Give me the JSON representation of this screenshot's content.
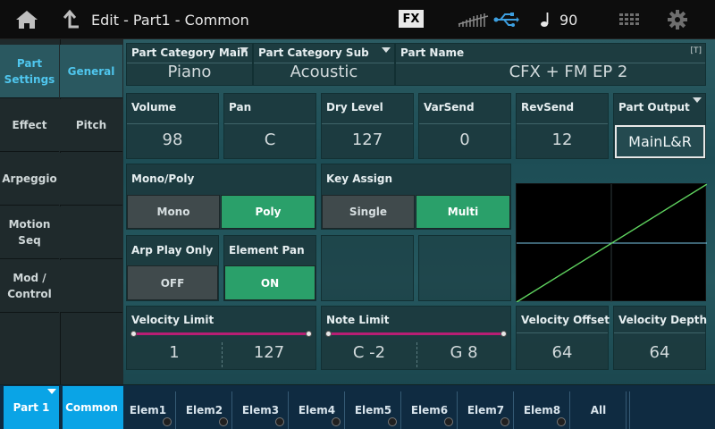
{
  "header": {
    "home_icon": "home-icon",
    "back_icon": "up-arrow-icon",
    "title": "Edit - Part1 - Common",
    "fx_label": "FX",
    "tempo_icon": "quarter-note-icon",
    "tempo": "90",
    "usb_icon": "usb-icon",
    "keyboard_icon": "keyboard-icon",
    "settings_icon": "gear-icon"
  },
  "nav_primary": [
    {
      "label": "Part\nSettings",
      "active": true
    },
    {
      "label": "Effect"
    },
    {
      "label": "Arpeggio"
    },
    {
      "label": "Motion\nSeq"
    },
    {
      "label": "Mod /\nControl"
    }
  ],
  "nav_secondary": [
    {
      "label": "General",
      "active": true
    },
    {
      "label": "Pitch"
    }
  ],
  "part": {
    "category_main_label": "Part Category Main",
    "category_main_value": "Piano",
    "category_sub_label": "Part Category Sub",
    "category_sub_value": "Acoustic",
    "name_label": "Part Name",
    "name_value": "CFX + FM EP 2",
    "name_badge": "[T]"
  },
  "params": {
    "volume_label": "Volume",
    "volume_value": "98",
    "pan_label": "Pan",
    "pan_value": "C",
    "dry_label": "Dry Level",
    "dry_value": "127",
    "varsend_label": "VarSend",
    "varsend_value": "0",
    "revsend_label": "RevSend",
    "revsend_value": "12",
    "output_label": "Part Output",
    "output_value": "MainL&R",
    "monopoly_label": "Mono/Poly",
    "mono_label": "Mono",
    "poly_label": "Poly",
    "keyassign_label": "Key Assign",
    "single_label": "Single",
    "multi_label": "Multi",
    "arp_label": "Arp Play Only",
    "arp_value": "OFF",
    "elempan_label": "Element Pan",
    "elempan_value": "ON",
    "vellimit_label": "Velocity Limit",
    "vellimit_low": "1",
    "vellimit_high": "127",
    "notelimit_label": "Note Limit",
    "notelimit_low": "C -2",
    "notelimit_high": "G 8",
    "veloffset_label": "Velocity Offset",
    "veloffset_value": "64",
    "veldepth_label": "Velocity Depth",
    "veldepth_value": "64"
  },
  "velocity_curve": {
    "offset": 64,
    "depth": 64
  },
  "colors": {
    "accent_blue": "#0aa4e6",
    "on_green": "#2aa06a",
    "slider_magenta": "#b81e74",
    "curve_green": "#5fd35f",
    "curve_center_line": "#7ac8e8"
  },
  "bottom_tabs": {
    "part": "Part 1",
    "common": "Common",
    "elements": [
      "Elem1",
      "Elem2",
      "Elem3",
      "Elem4",
      "Elem5",
      "Elem6",
      "Elem7",
      "Elem8"
    ],
    "all": "All"
  }
}
